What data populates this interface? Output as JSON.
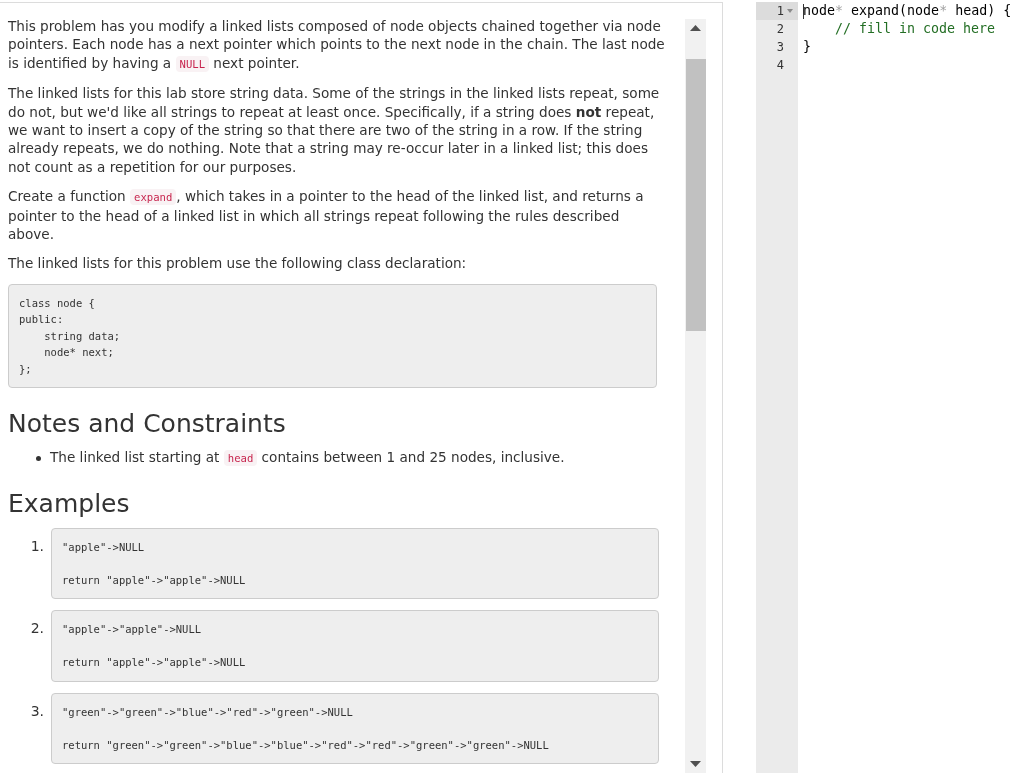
{
  "statement": {
    "paragraphs": [
      {
        "segments": [
          {
            "kind": "text",
            "text": "This problem has you modify a linked lists composed of node objects chained together via node pointers. Each node has a next pointer which points to the next node in the chain. The last node is identified by having a "
          },
          {
            "kind": "code",
            "text": "NULL"
          },
          {
            "kind": "text",
            "text": " next pointer."
          }
        ]
      },
      {
        "segments": [
          {
            "kind": "text",
            "text": "The linked lists for this lab store string data. Some of the strings in the linked lists repeat, some do not, but we'd like all strings to repeat at least once. Specifically, if a string does **not** repeat, we want to insert a copy of the string so that there are two of the string in a row. If the string already repeats, we do nothing. Note that a string may re-occur later in a linked list; this does not count as a repetition for our purposes."
          }
        ]
      },
      {
        "segments": [
          {
            "kind": "text",
            "text": "Create a function "
          },
          {
            "kind": "code",
            "text": "expand"
          },
          {
            "kind": "text",
            "text": ", which takes in a pointer to the head of the linked list, and returns a pointer to the head of a linked list in which all strings repeat following the rules described above."
          }
        ]
      },
      {
        "segments": [
          {
            "kind": "text",
            "text": "The linked lists for this problem use the following class declaration:"
          }
        ]
      }
    ],
    "code_block": {
      "lines": [
        "class node {",
        "public:",
        "    string data;",
        "    node* next;",
        "};"
      ]
    }
  },
  "notes": {
    "heading": "Notes and Constraints",
    "items": [
      {
        "segments": [
          {
            "kind": "text",
            "text": "The linked list starting at "
          },
          {
            "kind": "code",
            "text": "head"
          },
          {
            "kind": "text",
            "text": " contains between 1 and 25 nodes, inclusive."
          }
        ]
      }
    ]
  },
  "examples": {
    "heading": "Examples",
    "items": [
      {
        "number": "1.",
        "input": "\"apple\"->NULL",
        "output": "return \"apple\"->\"apple\"->NULL"
      },
      {
        "number": "2.",
        "input": "\"apple\"->\"apple\"->NULL",
        "output": "return \"apple\"->\"apple\"->NULL"
      },
      {
        "number": "3.",
        "input": "\"green\"->\"green\"->\"blue\"->\"red\"->\"green\"->NULL",
        "output": "return \"green\"->\"green\"->\"blue\"->\"blue\"->\"red\"->\"red\"->\"green\"->\"green\"->NULL"
      }
    ]
  },
  "editor": {
    "lines": [
      {
        "number": "1",
        "active": true,
        "foldable": true,
        "cursor": true,
        "tokens": [
          {
            "kind": "text",
            "text": "node"
          },
          {
            "kind": "operator",
            "text": "*"
          },
          {
            "kind": "text",
            "text": " expand(node"
          },
          {
            "kind": "operator",
            "text": "*"
          },
          {
            "kind": "text",
            "text": " head) {"
          }
        ]
      },
      {
        "number": "2",
        "active": false,
        "foldable": false,
        "cursor": false,
        "tokens": [
          {
            "kind": "comment",
            "text": "    // fill in code here"
          }
        ]
      },
      {
        "number": "3",
        "active": false,
        "foldable": false,
        "cursor": false,
        "tokens": [
          {
            "kind": "text",
            "text": "}"
          }
        ]
      },
      {
        "number": "4",
        "active": false,
        "foldable": false,
        "cursor": false
      }
    ]
  }
}
